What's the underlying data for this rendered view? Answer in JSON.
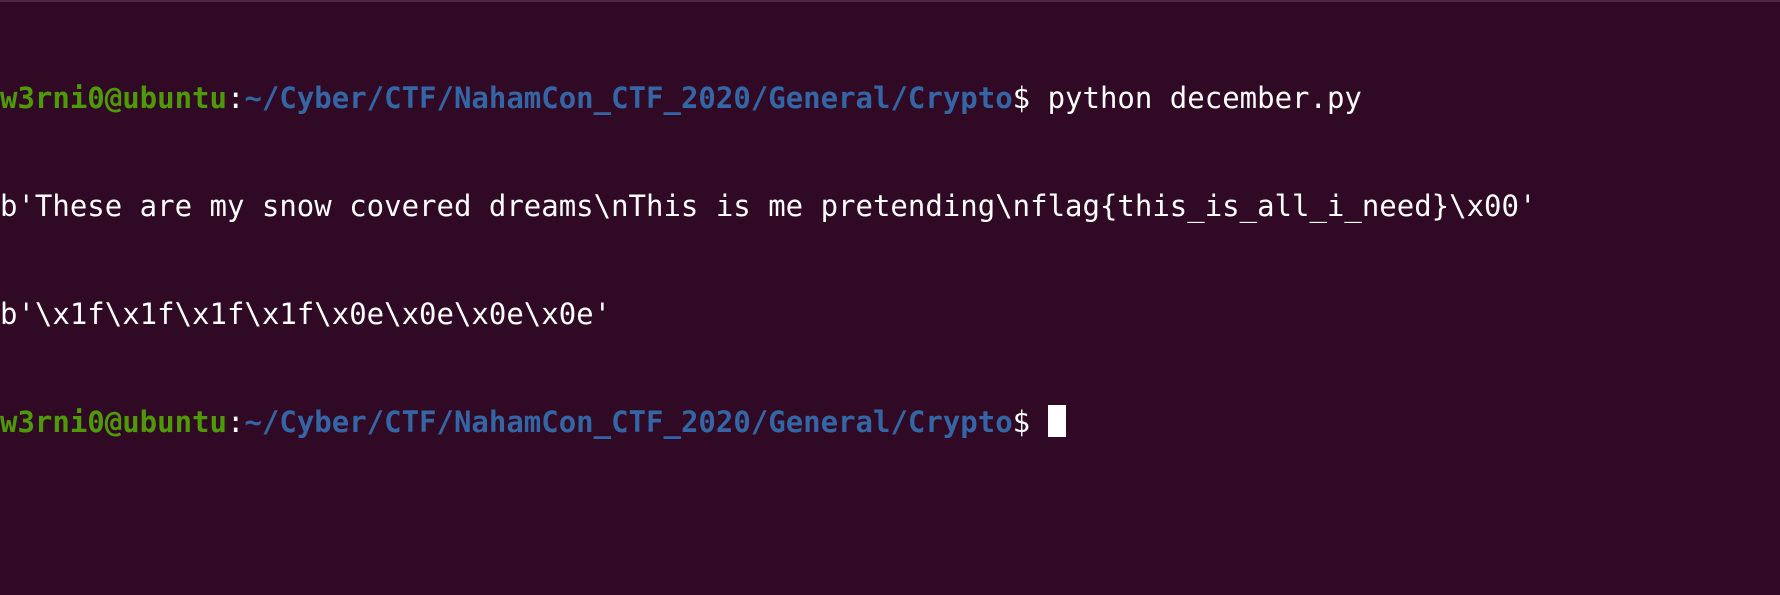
{
  "terminal": {
    "lines": [
      {
        "user_host": "w3rni0@ubuntu",
        "path": "~/Cyber/CTF/NahamCon_CTF_2020/General/Crypto",
        "prompt_symbol": "$ ",
        "command": "python december.py"
      },
      {
        "output": "b'These are my snow covered dreams\\nThis is me pretending\\nflag{this_is_all_i_need}\\x00'"
      },
      {
        "output": "b'\\x1f\\x1f\\x1f\\x1f\\x0e\\x0e\\x0e\\x0e'"
      },
      {
        "user_host": "w3rni0@ubuntu",
        "path": "~/Cyber/CTF/NahamCon_CTF_2020/General/Crypto",
        "prompt_symbol": "$ ",
        "command": ""
      }
    ],
    "colors": {
      "background": "#300a24",
      "user_host": "#4e9a06",
      "path": "#3465a4",
      "text": "#ffffff"
    }
  }
}
